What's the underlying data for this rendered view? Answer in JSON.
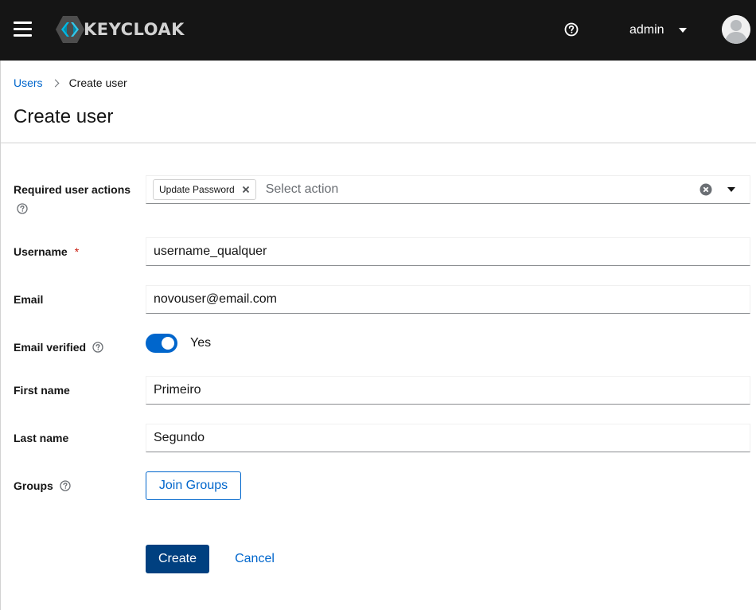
{
  "header": {
    "brand": "KEYCLOAK",
    "user_name": "admin",
    "menu_icon": "hamburger-menu-icon",
    "help_icon": "help-circle-icon"
  },
  "breadcrumb": {
    "parent": "Users",
    "current": "Create user"
  },
  "page_title": "Create user",
  "form": {
    "required_actions": {
      "label": "Required user actions",
      "chips": [
        "Update Password"
      ],
      "placeholder": "Select action"
    },
    "username": {
      "label": "Username",
      "required_marker": "*",
      "value": "username_qualquer"
    },
    "email": {
      "label": "Email",
      "value": "novouser@email.com"
    },
    "email_verified": {
      "label": "Email verified",
      "on": true,
      "state_label": "Yes"
    },
    "first_name": {
      "label": "First name",
      "value": "Primeiro"
    },
    "last_name": {
      "label": "Last name",
      "value": "Segundo"
    },
    "groups": {
      "label": "Groups",
      "button": "Join Groups"
    }
  },
  "actions": {
    "create": "Create",
    "cancel": "Cancel"
  },
  "colors": {
    "masthead": "#151515",
    "primary": "#004080",
    "link": "#0066cc",
    "required": "#c9190b"
  }
}
